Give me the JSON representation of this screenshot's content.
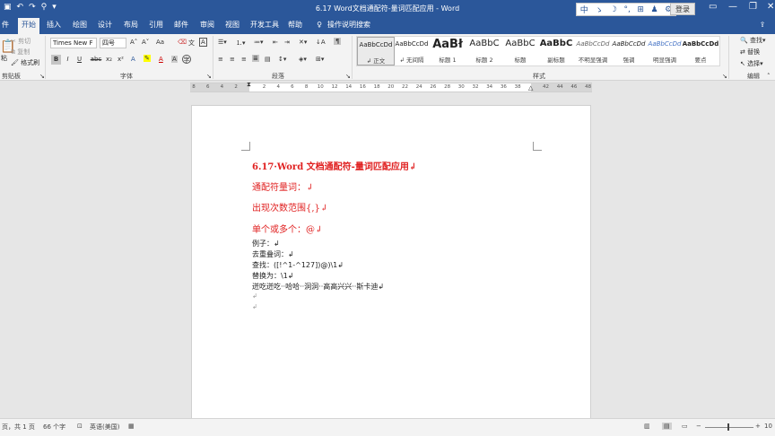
{
  "window": {
    "title": "6.17 Word文档通配符-量词匹配应用  -  Word",
    "login": "登录",
    "ime": [
      "中",
      "ゝ",
      "☽",
      "°,",
      "⊞",
      "♟",
      "⚙"
    ]
  },
  "tabs": [
    "件",
    "开始",
    "插入",
    "绘图",
    "设计",
    "布局",
    "引用",
    "邮件",
    "审阅",
    "视图",
    "开发工具",
    "帮助",
    "操作说明搜索"
  ],
  "ribbon": {
    "clipboard": {
      "label": "剪贴板",
      "cut": "剪切",
      "copy": "复制",
      "paste": "粘",
      "format_painter": "格式刷"
    },
    "font": {
      "label": "字体",
      "font_name": "Times New F",
      "font_size": "四号",
      "grow": "A˄",
      "shrink": "A˅",
      "case": "Aa",
      "bold": "B",
      "italic": "I",
      "underline": "U",
      "strike": "abc",
      "sub": "x₂",
      "sup": "x²"
    },
    "paragraph": {
      "label": "段落"
    },
    "styles": {
      "label": "样式",
      "items": [
        {
          "sample": "AaBbCcDd",
          "name": "↲ 正文"
        },
        {
          "sample": "AaBbCcDd",
          "name": "↲ 无间隔"
        },
        {
          "sample": "AaBł",
          "name": "标题 1"
        },
        {
          "sample": "AaBbC",
          "name": "标题 2"
        },
        {
          "sample": "AaBbC",
          "name": "标题"
        },
        {
          "sample": "AaBbC",
          "name": "副标题"
        },
        {
          "sample": "AaBbCcDd",
          "name": "不明显强调"
        },
        {
          "sample": "AaBbCcDd",
          "name": "强调"
        },
        {
          "sample": "AaBbCcDd",
          "name": "明显强调"
        },
        {
          "sample": "AaBbCcDd",
          "name": "要点"
        }
      ]
    },
    "editing": {
      "label": "编辑",
      "find": "查找",
      "replace": "替换",
      "select": "选择"
    }
  },
  "ruler": [
    "8",
    "6",
    "4",
    "2",
    "",
    "2",
    "4",
    "6",
    "8",
    "10",
    "12",
    "14",
    "16",
    "18",
    "20",
    "22",
    "24",
    "26",
    "28",
    "30",
    "32",
    "34",
    "36",
    "38",
    "",
    "42",
    "44",
    "46",
    "48"
  ],
  "document": {
    "heading": "6.17·Word 文档通配符-量词匹配应用↲",
    "sub1": "通配符量词：↲",
    "sub2": "出现次数范围{,}↲",
    "sub3": "单个或多个：@↲",
    "line1": "例子：↲",
    "line2": "去重叠词：↲",
    "line3": "查找：([!^1-^127])@)\\1↲",
    "line4": "替换为：\\1↲",
    "line5": "迸吃迸吃··哈哈··洞洞··高高兴兴··斯卡迪↲",
    "empty1": "↲",
    "empty2": "↲"
  },
  "status": {
    "page": "页，共 1 页",
    "words": "66 个字",
    "lang": "英语(美国)",
    "zoom": "10"
  }
}
